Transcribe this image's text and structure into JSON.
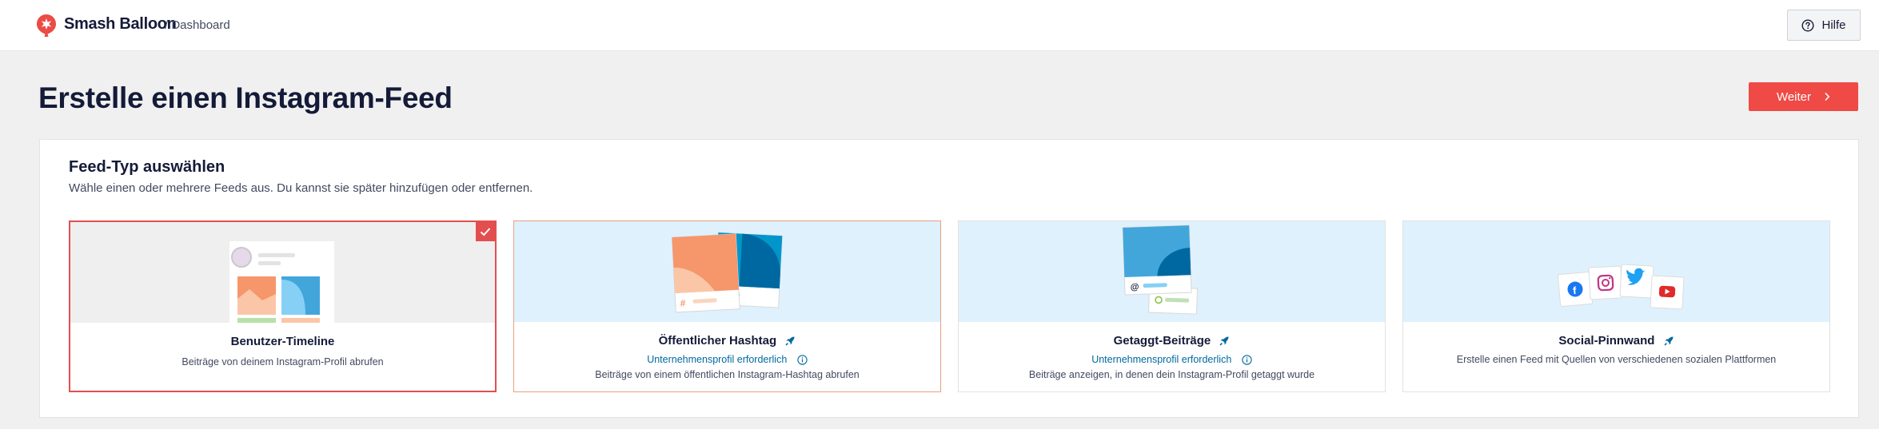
{
  "header": {
    "brand": "Smash Balloon",
    "breadcrumb": "/ Dashboard",
    "help_label": "Hilfe"
  },
  "page": {
    "title": "Erstelle einen Instagram-Feed",
    "next_label": "Weiter"
  },
  "panel": {
    "title": "Feed-Typ auswählen",
    "subtitle": "Wähle einen oder mehrere Feeds aus. Du kannst sie später hinzufügen oder entfernen."
  },
  "cards": [
    {
      "title": "Benutzer-Timeline",
      "link": "",
      "description": "Beiträge von deinem Instagram-Profil abrufen",
      "selected": true
    },
    {
      "title": "Öffentlicher Hashtag",
      "link": "Unternehmensprofil erforderlich",
      "description": "Beiträge von einem öffentlichen Instagram-Hashtag abrufen",
      "selected": false
    },
    {
      "title": "Getaggt-Beiträge",
      "link": "Unternehmensprofil erforderlich",
      "description": "Beiträge anzeigen, in denen dein Instagram-Profil getaggt wurde",
      "selected": false
    },
    {
      "title": "Social-Pinnwand",
      "link": "",
      "description": "Erstelle einen Feed mit Quellen von verschiedenen sozialen Plattformen",
      "selected": false
    }
  ],
  "colors": {
    "accent": "#ef4a45",
    "selected_border": "#e34f4f",
    "link": "#0068a0",
    "card_art_bg": "#dff1fc"
  }
}
